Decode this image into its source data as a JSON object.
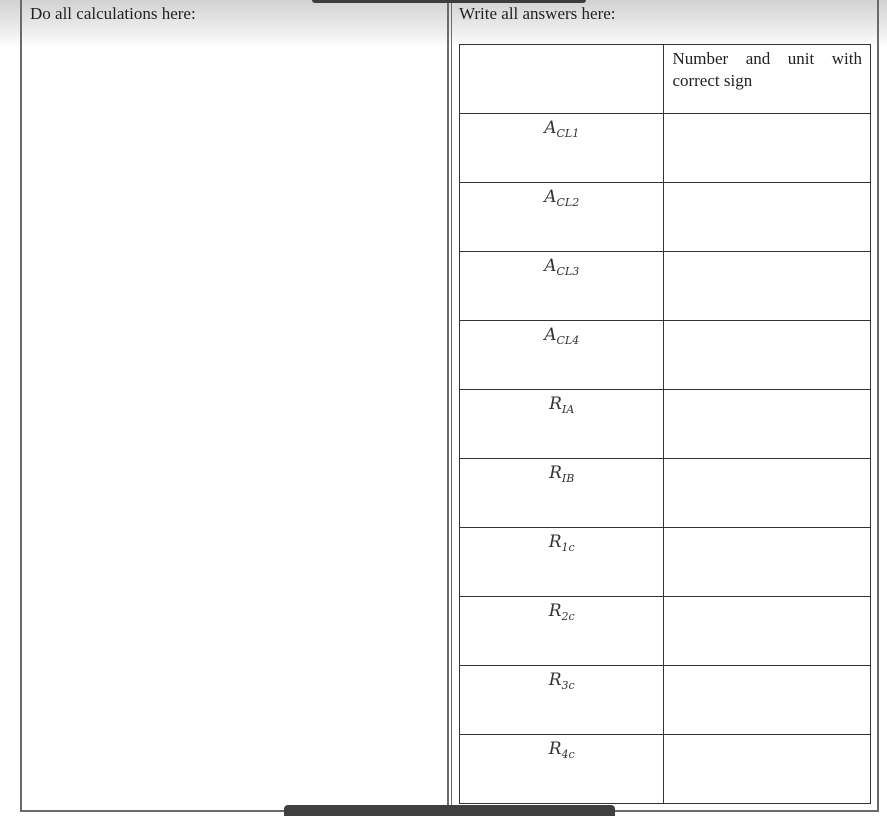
{
  "left_panel": {
    "heading": "Do all calculations here:"
  },
  "right_panel": {
    "heading": "Write all answers here:",
    "table": {
      "header": {
        "quantity": "",
        "value": "Number and unit with correct sign"
      },
      "rows": [
        {
          "base": "A",
          "sub": "CL1",
          "value": ""
        },
        {
          "base": "A",
          "sub": "CL2",
          "value": ""
        },
        {
          "base": "A",
          "sub": "CL3",
          "value": ""
        },
        {
          "base": "A",
          "sub": "CL4",
          "value": ""
        },
        {
          "base": "R",
          "sub": "IA",
          "value": ""
        },
        {
          "base": "R",
          "sub": "IB",
          "value": ""
        },
        {
          "base": "R",
          "sub": "1c",
          "value": ""
        },
        {
          "base": "R",
          "sub": "2c",
          "value": ""
        },
        {
          "base": "R",
          "sub": "3c",
          "value": ""
        },
        {
          "base": "R",
          "sub": "4c",
          "value": ""
        }
      ]
    }
  }
}
